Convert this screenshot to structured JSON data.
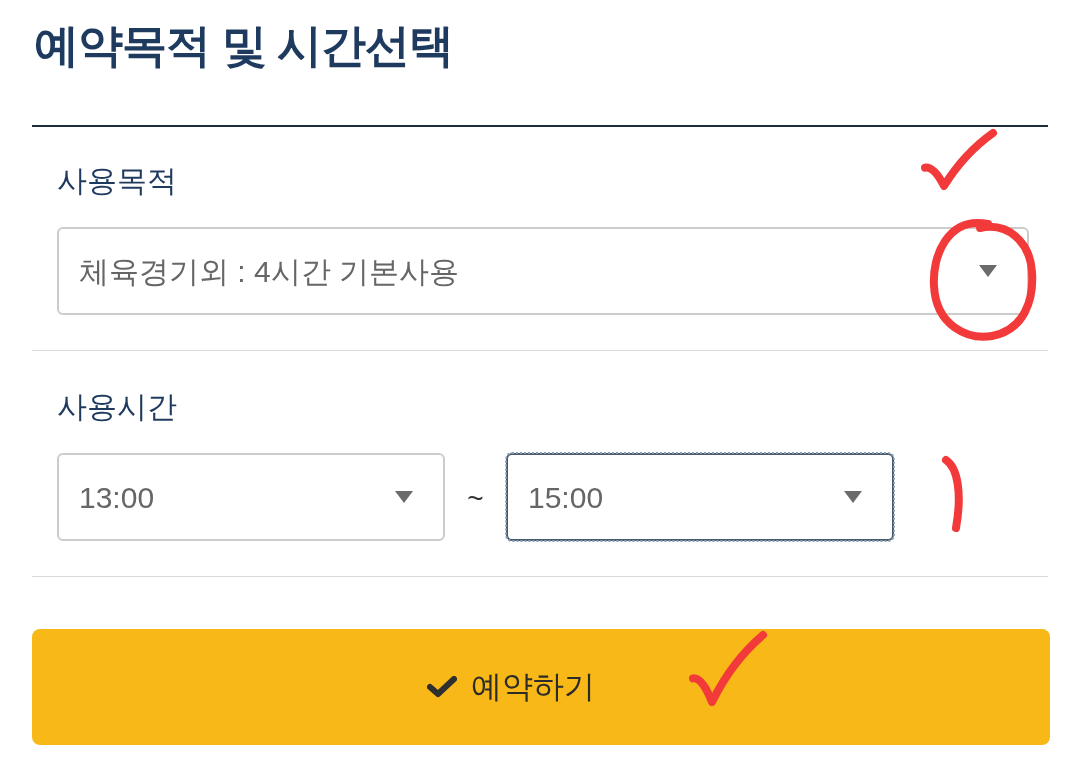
{
  "title": "예약목적 및 시간선택",
  "purpose": {
    "label": "사용목적",
    "select": {
      "value": "체육경기외 : 4시간 기본사용",
      "focused": false
    }
  },
  "time": {
    "label": "사용시간",
    "start": {
      "value": "13:00",
      "focused": false
    },
    "separator": "~",
    "end": {
      "value": "15:00",
      "focused": true
    }
  },
  "submit_button": {
    "label": "예약하기"
  },
  "annotations": [
    {
      "kind": "check"
    },
    {
      "kind": "circle"
    },
    {
      "kind": "bracket"
    },
    {
      "kind": "check"
    }
  ]
}
